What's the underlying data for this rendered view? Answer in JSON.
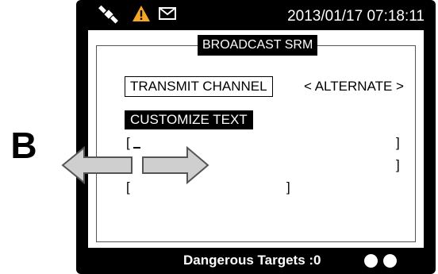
{
  "annotation": {
    "letter": "B"
  },
  "status_bar": {
    "datetime": "2013/01/17 07:18:11",
    "icons": [
      "satellite-icon",
      "warning-icon",
      "envelope-icon"
    ],
    "warning_color": "#f5a623"
  },
  "dialog": {
    "title": "BROADCAST SRM",
    "transmit_channel": {
      "label": "TRANSMIT CHANNEL",
      "value": "< ALTERNATE >"
    },
    "customize_text": {
      "label": "CUSTOMIZE TEXT",
      "line1_open": "[",
      "line1_close": "]",
      "line2_close": "]",
      "line3_open": "[",
      "line3_close": "]"
    }
  },
  "footer": {
    "dangerous_targets": "Dangerous Targets :0",
    "indicators": [
      "dot",
      "dot"
    ]
  },
  "arrows": [
    "arrow-left-icon",
    "arrow-right-icon"
  ],
  "colors": {
    "bezel": "#000000",
    "screen": "#ffffff",
    "arrow_fill": "#cfcfcf"
  }
}
